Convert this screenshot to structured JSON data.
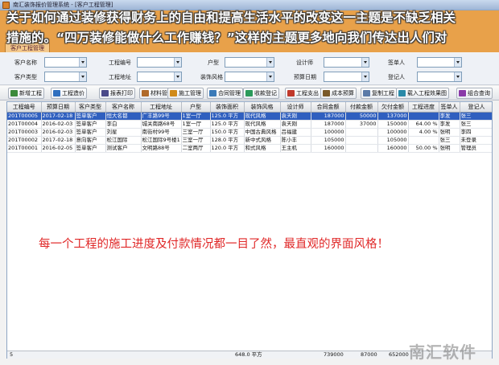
{
  "window": {
    "title": "南汇装饰报价管理系统 - [客户工程管理]"
  },
  "tab": {
    "label": "客户工程管理"
  },
  "banner": {
    "line1": "关于如何通过装修获得财务上的自由和提高生活水平的改变这一主题是不缺乏相关",
    "line2": "措施的。“四万装修能做什么工作赚钱？”这样的主题更多地向我们传达出人们对"
  },
  "filters": [
    {
      "label": "客户名称",
      "value": ""
    },
    {
      "label": "工程编号",
      "value": ""
    },
    {
      "label": "户型",
      "value": ""
    },
    {
      "label": "设计师",
      "value": ""
    },
    {
      "label": "签单人",
      "value": ""
    },
    {
      "label": "客户类型",
      "value": ""
    },
    {
      "label": "工程地址",
      "value": ""
    },
    {
      "label": "装饰风格",
      "value": ""
    },
    {
      "label": "预算日期",
      "value": ""
    },
    {
      "label": "登记人",
      "value": ""
    }
  ],
  "toolbar": [
    {
      "label": "新增工程",
      "icon": "add-icon",
      "color": "#3b8a3b"
    },
    {
      "label": "工程造价",
      "icon": "calc-icon",
      "color": "#2f6fbf"
    },
    {
      "label": "报表打印",
      "icon": "print-icon",
      "color": "#4a4a8a"
    },
    {
      "label": "材料管理",
      "icon": "material-icon",
      "color": "#b06a2a"
    },
    {
      "label": "施工管理",
      "icon": "construction-icon",
      "color": "#d08a1a"
    },
    {
      "label": "合同管理",
      "icon": "contract-icon",
      "color": "#3a7ab8"
    },
    {
      "label": "收款登记",
      "icon": "payment-icon",
      "color": "#2a9a5a"
    },
    {
      "label": "工程支出",
      "icon": "expense-icon",
      "color": "#c0392b"
    },
    {
      "label": "成本预算",
      "icon": "budget-icon",
      "color": "#7a5a2a"
    },
    {
      "label": "复制工程",
      "icon": "copy-icon",
      "color": "#5a7aa8"
    },
    {
      "label": "载入工程效果图",
      "icon": "image-icon",
      "color": "#2a8aa8"
    },
    {
      "label": "组合查询",
      "icon": "search-icon",
      "color": "#8a3aa8"
    }
  ],
  "table": {
    "columns": [
      "工程编号",
      "预算日期",
      "客户类型",
      "客户名称",
      "工程地址",
      "户型",
      "装饰面积",
      "装饰风格",
      "设计师",
      "合同金额",
      "付款金额",
      "欠付金额",
      "工程进度",
      "签单人",
      "登记人"
    ],
    "rows": [
      [
        "201T00005",
        "2017-02-18",
        "签单客户",
        "恒大名都",
        "广丰路99号",
        "1室一厅",
        "125.0 平方",
        "现代风格",
        "袁天刚",
        "187000",
        "50000",
        "137000",
        "",
        "李发",
        "张三"
      ],
      [
        "201T00004",
        "2016-02-03",
        "签单客户",
        "李白",
        "城关南路68号",
        "1室一厅",
        "125.0 平方",
        "现代风格",
        "袁天刚",
        "187000",
        "37000",
        "150000",
        "64.00 %",
        "李发",
        "张三"
      ],
      [
        "201T00003",
        "2016-02-03",
        "签单客户",
        "刘星",
        "南街村99号",
        "三室一厅",
        "150.0 平方",
        "中国古典风格",
        "吕福建",
        "100000",
        "",
        "100000",
        "4.00 %",
        "张明",
        "李四"
      ],
      [
        "201T00002",
        "2017-02-18",
        "意向客户",
        "松江国际",
        "松江国际9号楼1",
        "三室一厅",
        "128.0 平方",
        "新中式风格",
        "陈小丰",
        "105000",
        "",
        "105000",
        "",
        "张三",
        "未登录"
      ],
      [
        "201T00001",
        "2016-02-05",
        "签单客户",
        "测试客户",
        "文明路88号",
        "二室两厅",
        "120.0 平方",
        "和式风格",
        "王主机",
        "160000",
        "",
        "160000",
        "50.00 %",
        "张明",
        "管理员"
      ]
    ],
    "selected_index": 0
  },
  "footer": {
    "count": "5",
    "area_total": "648.0 平方",
    "contract_total": "739000",
    "paid_total": "87000",
    "owed_total": "652000"
  },
  "message": "每一个工程的施工进度及付款情况都一目了然，最直观的界面风格！",
  "watermark": "南汇软件"
}
